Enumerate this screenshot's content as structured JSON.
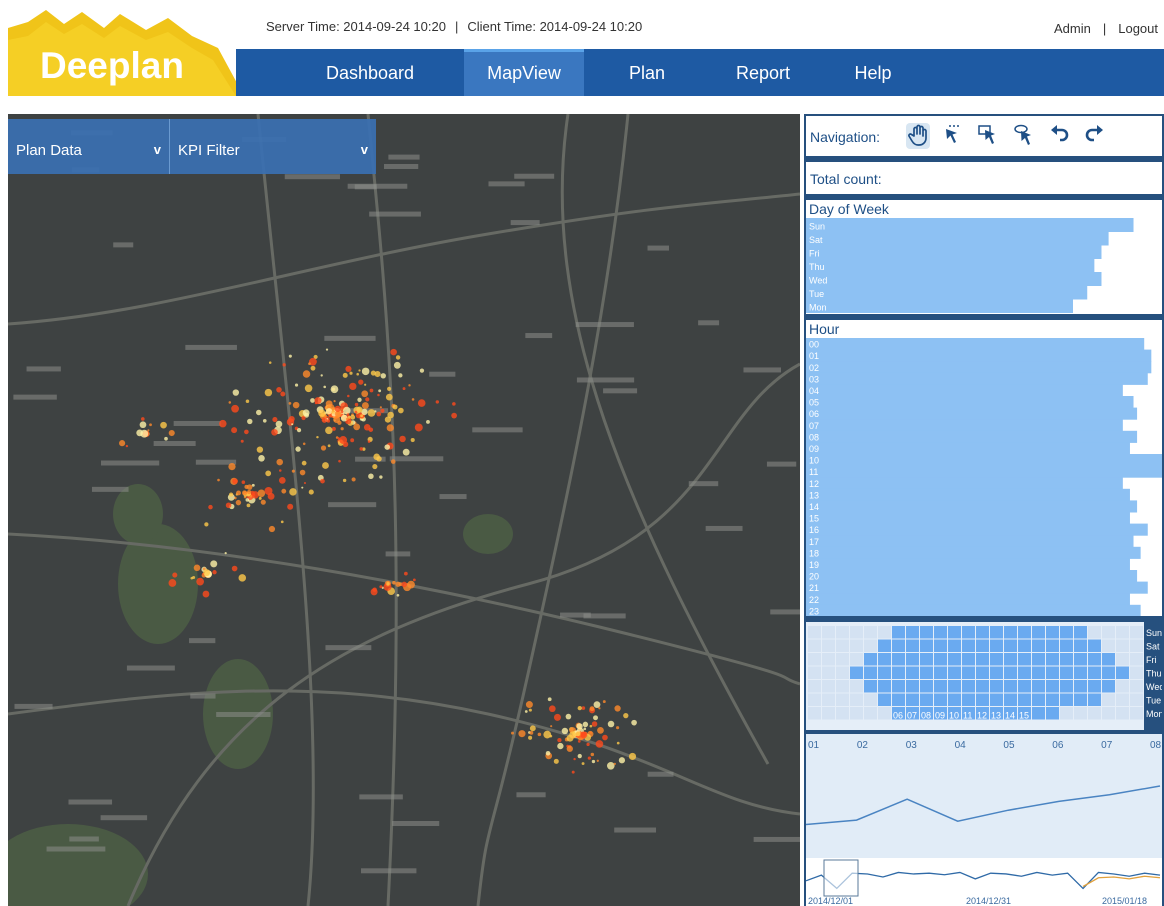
{
  "app": {
    "logo_text": "Deeplan"
  },
  "topbar": {
    "server_time": "Server Time: 2014-09-24 10:20",
    "separator": "|",
    "client_time": "Client Time: 2014-09-24 10:20",
    "user": "Admin",
    "logout": "Logout"
  },
  "nav": {
    "items": [
      "Dashboard",
      "MapView",
      "Plan",
      "Report",
      "Help"
    ],
    "active": "MapView"
  },
  "map_filters": {
    "plan_data": "Plan Data",
    "kpi_filter": "KPI Filter",
    "chevron": "v"
  },
  "navigation": {
    "label": "Navigation:",
    "tools": [
      "hand-pan-icon",
      "cursor-select-icon",
      "cursor-box-select-icon",
      "cursor-lasso-icon",
      "undo-icon",
      "redo-icon"
    ],
    "active_tool": "hand-pan-icon"
  },
  "total": {
    "label": "Total count:"
  },
  "colors": {
    "brand_blue": "#1e5aa3",
    "logo_yellow": "#f0c419",
    "bar_fill": "#8dc1f3",
    "map_bg": "#3e4242"
  },
  "chart_data": [
    {
      "type": "bar",
      "title": "Day of Week",
      "categories": [
        "Sun",
        "Sat",
        "Fri",
        "Thu",
        "Wed",
        "Tue",
        "Mon"
      ],
      "values": [
        92,
        85,
        83,
        81,
        83,
        79,
        75
      ],
      "orientation": "horizontal",
      "xlim": [
        0,
        100
      ]
    },
    {
      "type": "bar",
      "title": "Hour",
      "categories": [
        "00",
        "01",
        "02",
        "03",
        "04",
        "05",
        "06",
        "07",
        "08",
        "09",
        "10",
        "11",
        "12",
        "13",
        "14",
        "15",
        "16",
        "17",
        "18",
        "19",
        "20",
        "21",
        "22",
        "23"
      ],
      "values": [
        95,
        97,
        97,
        96,
        89,
        92,
        93,
        89,
        93,
        91,
        100,
        100,
        89,
        91,
        93,
        91,
        96,
        92,
        94,
        91,
        93,
        96,
        91,
        94
      ],
      "orientation": "horizontal",
      "xlim": [
        0,
        100
      ]
    },
    {
      "type": "heatmap",
      "rows": [
        "Sun",
        "Sat",
        "Fri",
        "Thu",
        "Wed",
        "Tue",
        "Mon"
      ],
      "columns": [
        "00",
        "01",
        "02",
        "03",
        "04",
        "05",
        "06",
        "07",
        "08",
        "09",
        "10",
        "11",
        "12",
        "13",
        "14",
        "15",
        "16",
        "17",
        "18",
        "19",
        "20",
        "21",
        "22",
        "23"
      ],
      "row_active_ranges": [
        [
          6,
          19
        ],
        [
          5,
          20
        ],
        [
          4,
          21
        ],
        [
          3,
          22
        ],
        [
          4,
          21
        ],
        [
          5,
          20
        ],
        [
          6,
          17
        ]
      ],
      "column_labels_visible": [
        "06",
        "07",
        "08",
        "09",
        "10",
        "11",
        "12",
        "13",
        "14",
        "15"
      ]
    },
    {
      "type": "line",
      "x_ticks": [
        "01",
        "02",
        "03",
        "04",
        "05",
        "06",
        "07",
        "08"
      ],
      "x": [
        1,
        2,
        3,
        4,
        5,
        6,
        7,
        8
      ],
      "values": [
        25,
        29,
        48,
        28,
        38,
        46,
        52,
        60
      ],
      "ylim": [
        0,
        100
      ]
    },
    {
      "type": "line",
      "x_ticks": [
        "2014/12/01",
        "2014/12/31",
        "2015/01/18"
      ],
      "series": [
        {
          "color": "#2f6aa7",
          "values": [
            40,
            55,
            20,
            60,
            58,
            50,
            62,
            58,
            60,
            56,
            62,
            45,
            60,
            58,
            52,
            62,
            55,
            60,
            20,
            62,
            58,
            52,
            60,
            55
          ]
        },
        {
          "color": "#e0a03c",
          "values": [
            null,
            null,
            null,
            null,
            null,
            null,
            null,
            null,
            null,
            null,
            null,
            null,
            null,
            null,
            null,
            null,
            null,
            null,
            25,
            48,
            50,
            45,
            52,
            48
          ]
        }
      ],
      "ylim": [
        0,
        100
      ]
    }
  ]
}
